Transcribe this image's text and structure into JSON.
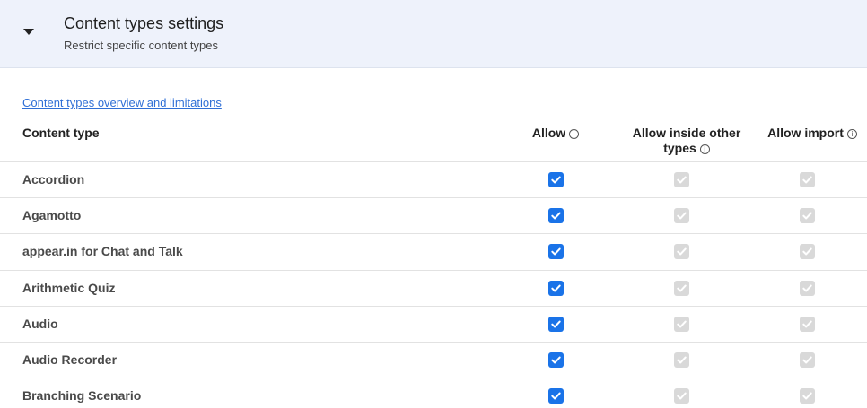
{
  "header": {
    "title": "Content types settings",
    "subtitle": "Restrict specific content types"
  },
  "overview_link": "Content types overview and limitations",
  "columns": {
    "type": "Content type",
    "allow": "Allow",
    "inside": "Allow inside other types",
    "import": "Allow import"
  },
  "rows": [
    {
      "label": "Accordion",
      "allow": true,
      "inside": true,
      "import": true
    },
    {
      "label": "Agamotto",
      "allow": true,
      "inside": true,
      "import": true
    },
    {
      "label": "appear.in for Chat and Talk",
      "allow": true,
      "inside": true,
      "import": true
    },
    {
      "label": "Arithmetic Quiz",
      "allow": true,
      "inside": true,
      "import": true
    },
    {
      "label": "Audio",
      "allow": true,
      "inside": true,
      "import": true
    },
    {
      "label": "Audio Recorder",
      "allow": true,
      "inside": true,
      "import": true
    },
    {
      "label": "Branching Scenario",
      "allow": true,
      "inside": true,
      "import": true
    }
  ],
  "colors": {
    "accent": "#1a73e8",
    "disabled": "#d9d9d9",
    "header_bg": "#eef2fb",
    "link": "#2f6fd6"
  }
}
